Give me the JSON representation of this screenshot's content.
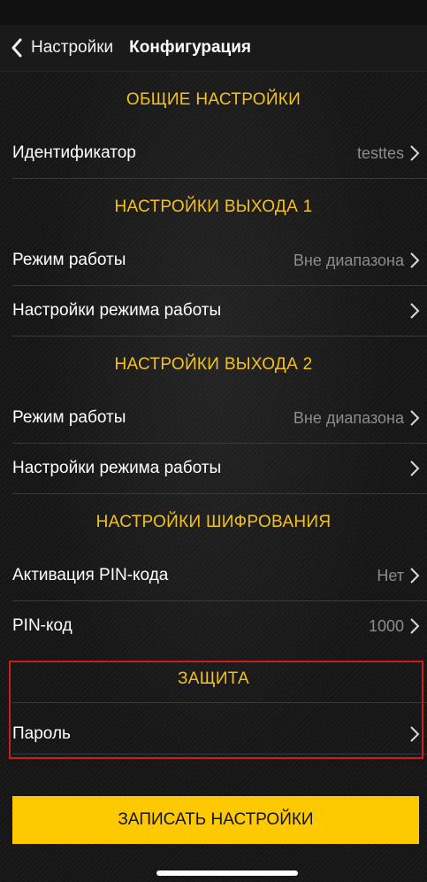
{
  "nav": {
    "back_label": "Настройки",
    "title": "Конфигурация"
  },
  "sections": {
    "general": {
      "header": "ОБЩИЕ НАСТРОЙКИ",
      "identifier": {
        "label": "Идентификатор",
        "value": "testtes"
      }
    },
    "output1": {
      "header": "НАСТРОЙКИ ВЫХОДА 1",
      "mode": {
        "label": "Режим работы",
        "value": "Вне диапазона"
      },
      "mode_settings": {
        "label": "Настройки режима работы"
      }
    },
    "output2": {
      "header": "НАСТРОЙКИ ВЫХОДА 2",
      "mode": {
        "label": "Режим работы",
        "value": "Вне диапазона"
      },
      "mode_settings": {
        "label": "Настройки режима работы"
      }
    },
    "encryption": {
      "header": "НАСТРОЙКИ ШИФРОВАНИЯ",
      "pin_activation": {
        "label": "Активация PIN-кода",
        "value": "Нет"
      },
      "pin_code": {
        "label": "PIN-код",
        "value": "1000"
      }
    },
    "protection": {
      "header": "ЗАЩИТА",
      "password": {
        "label": "Пароль"
      }
    }
  },
  "save_button_label": "ЗАПИСАТЬ НАСТРОЙКИ",
  "colors": {
    "accent_yellow": "#f4c21b",
    "button_yellow": "#ffc900",
    "highlight_red": "#d11a1a",
    "value_gray": "#8c8c8c"
  },
  "icons": {
    "back": "chevron-left-icon",
    "row_disclosure": "chevron-right-icon"
  }
}
